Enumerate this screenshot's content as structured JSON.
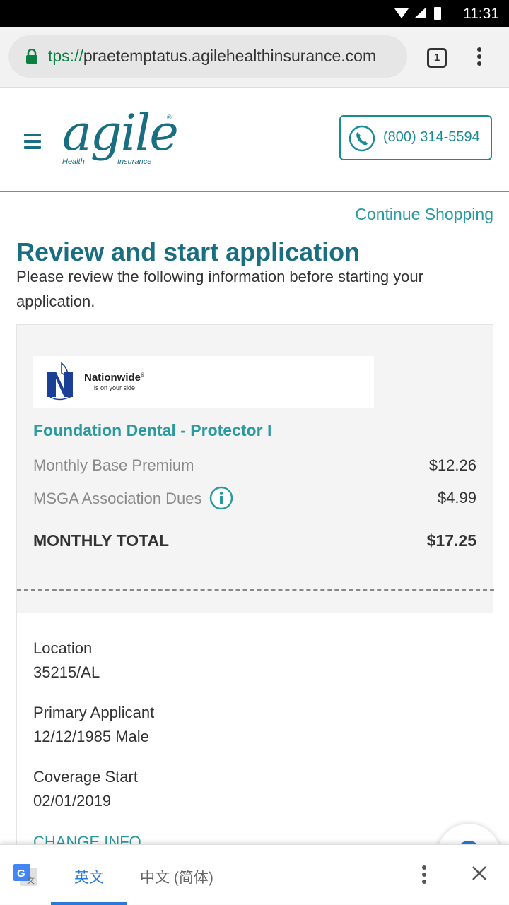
{
  "status_bar": {
    "time": "11:31"
  },
  "browser": {
    "url_scheme": "tps://",
    "url_host": "praetemptatus.agilehealthinsurance.com",
    "tab_count": "1"
  },
  "header": {
    "logo_main": "agile",
    "logo_sub_1": "Health",
    "logo_sub_2": "Insurance",
    "logo_reg": "®",
    "phone": "(800) 314-5594"
  },
  "page": {
    "continue_link": "Continue Shopping",
    "title": "Review and start application",
    "description": "Please review the following information before starting your application."
  },
  "summary": {
    "carrier_name": "Nationwide",
    "carrier_reg": "®",
    "carrier_tagline": "is on your side",
    "plan_name": "Foundation Dental - Protector I",
    "base_premium_label": "Monthly Base Premium",
    "base_premium_value": "$12.26",
    "dues_label": "MSGA Association Dues",
    "dues_value": "$4.99",
    "total_label": "MONTHLY TOTAL",
    "total_value": "$17.25"
  },
  "details": {
    "location_label": "Location",
    "location_value": "35215/AL",
    "applicant_label": "Primary Applicant",
    "applicant_value": "12/12/1985 Male",
    "coverage_label": "Coverage Start",
    "coverage_value": "02/01/2019",
    "change_info": "CHANGE INFO"
  },
  "translate_bar": {
    "lang_1": "英文",
    "lang_2": "中文 (简体)"
  },
  "colors": {
    "brand_dark": "#1a6e82",
    "brand_teal": "#2a9a9f",
    "translate_blue": "#2979d6"
  }
}
